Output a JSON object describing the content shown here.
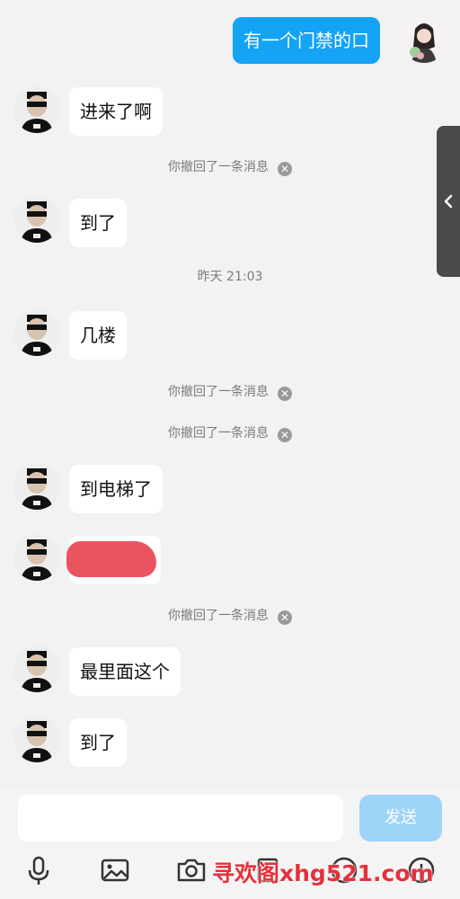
{
  "messages": {
    "outgoing_1": "有一个门禁的口",
    "in_1": "进来了啊",
    "in_2": "到了",
    "in_3": "几楼",
    "in_4": "到电梯了",
    "in_5": "最里面这个",
    "in_6": "到了"
  },
  "system": {
    "recall_1": "你撤回了一条消息",
    "timestamp": "昨天 21:03",
    "recall_2": "你撤回了一条消息",
    "recall_3": "你撤回了一条消息",
    "recall_4": "你撤回了一条消息"
  },
  "composer": {
    "placeholder": "",
    "send_label": "发送"
  },
  "toolbar": {
    "icons": [
      "microphone-icon",
      "image-icon",
      "camera-icon",
      "file-icon",
      "emoji-icon",
      "plus-icon"
    ]
  },
  "watermark": "寻欢阁xhg521.com",
  "colors": {
    "outgoing_bubble": "#14a3f5",
    "send_button": "#9ed4f8",
    "redaction": "#e95460"
  }
}
